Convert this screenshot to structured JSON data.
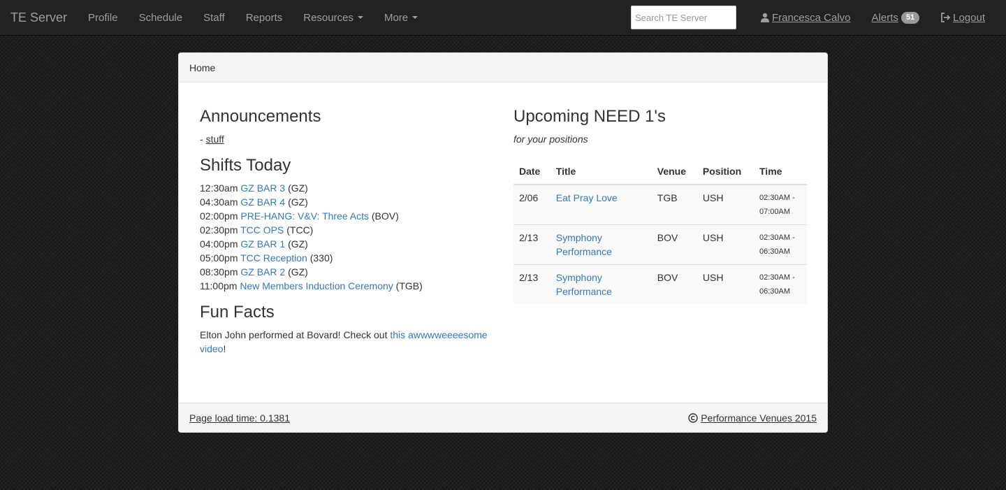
{
  "navbar": {
    "brand": "TE Server",
    "items": [
      {
        "label": "Profile"
      },
      {
        "label": "Schedule"
      },
      {
        "label": "Staff"
      },
      {
        "label": "Reports"
      },
      {
        "label": "Resources",
        "dropdown": true
      },
      {
        "label": "More",
        "dropdown": true
      }
    ],
    "search_placeholder": "Search TE Server",
    "user_name": "Francesca Calvo",
    "alerts_label": "Alerts",
    "alerts_count": "51",
    "logout_label": "Logout"
  },
  "breadcrumb": "Home",
  "announcements": {
    "title": "Announcements",
    "prefix": "- ",
    "link_text": "stuff"
  },
  "shifts_today": {
    "title": "Shifts Today",
    "items": [
      {
        "time": "12:30am",
        "name": "GZ BAR 3",
        "venue": "(GZ)"
      },
      {
        "time": "04:30am",
        "name": "GZ BAR 4",
        "venue": "(GZ)"
      },
      {
        "time": "02:00pm",
        "name": "PRE-HANG: V&V: Three Acts",
        "venue": "(BOV)"
      },
      {
        "time": "02:30pm",
        "name": "TCC OPS",
        "venue": "(TCC)"
      },
      {
        "time": "04:00pm",
        "name": "GZ BAR 1",
        "venue": "(GZ)"
      },
      {
        "time": "05:00pm",
        "name": "TCC Reception",
        "venue": "(330)"
      },
      {
        "time": "08:30pm",
        "name": "GZ BAR 2",
        "venue": "(GZ)"
      },
      {
        "time": "11:00pm",
        "name": "New Members Induction Ceremony",
        "venue": "(TGB)"
      }
    ]
  },
  "fun_facts": {
    "title": "Fun Facts",
    "text": "Elton John performed at Bovard! Check out ",
    "link_text": "this awwwweeeesome video",
    "suffix": "!"
  },
  "upcoming": {
    "title": "Upcoming NEED 1's",
    "subtitle": "for your positions",
    "columns": [
      "Date",
      "Title",
      "Venue",
      "Position",
      "Time"
    ],
    "rows": [
      {
        "date": "2/06",
        "title": "Eat Pray Love",
        "venue": "TGB",
        "position": "USH",
        "time_start": "02:30AM -",
        "time_end": "07:00AM"
      },
      {
        "date": "2/13",
        "title": "Symphony Performance",
        "venue": "BOV",
        "position": "USH",
        "time_start": "02:30AM -",
        "time_end": "06:30AM"
      },
      {
        "date": "2/13",
        "title": "Symphony Performance",
        "venue": "BOV",
        "position": "USH",
        "time_start": "02:30AM -",
        "time_end": "06:30AM"
      }
    ]
  },
  "footer": {
    "load_time": "Page load time: 0.1381",
    "copyright": "Performance Venues 2015"
  }
}
